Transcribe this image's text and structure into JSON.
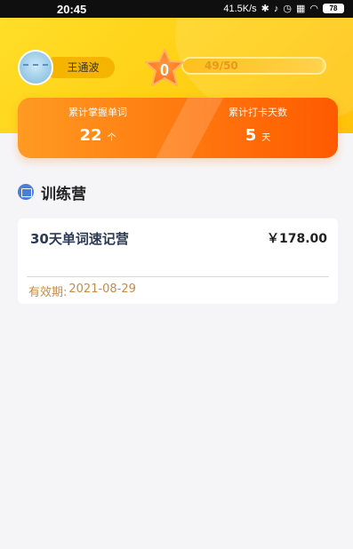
{
  "status_bar": {
    "time": "20:45",
    "network_speed": "41.5K/s",
    "battery": "78"
  },
  "profile": {
    "name": "王通波",
    "star_count": "0",
    "progress_text": "49/50",
    "progress_fraction": 0.98
  },
  "stats": {
    "mastered_label": "累计掌握单词",
    "mastered_value": "22",
    "mastered_unit": "个",
    "checkin_label": "累计打卡天数",
    "checkin_value": "5",
    "checkin_unit": "天"
  },
  "section": {
    "title": "训练营"
  },
  "course": {
    "name": "30天单词速记营",
    "price": "￥178.00",
    "valid_label": "有效期:",
    "valid_date": "2021-08-29"
  },
  "colors": {
    "header": "#ffd21a",
    "stats_card": "#ff7a10",
    "accent_blue": "#4a7fd6",
    "valid_text": "#c98a45"
  }
}
